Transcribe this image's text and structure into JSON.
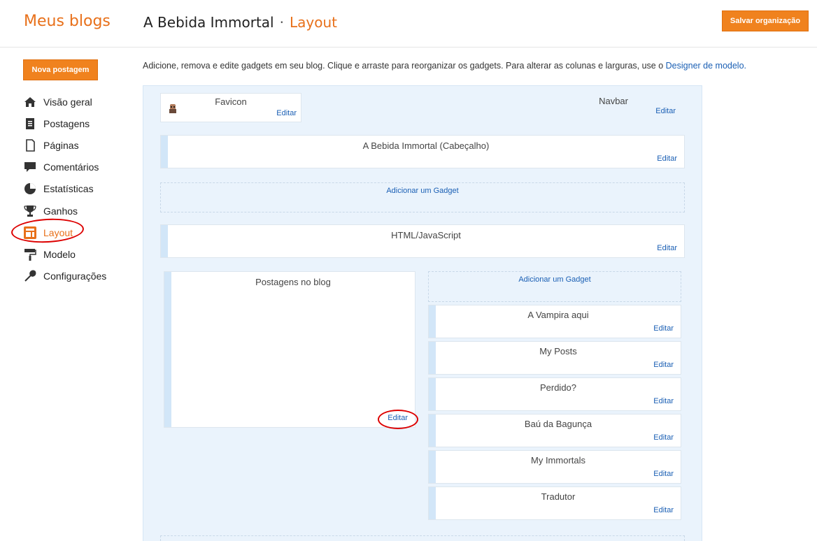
{
  "header": {
    "brand": "Meus blogs",
    "blog_name": "A Bebida Immortal",
    "separator": "·",
    "current": "Layout",
    "save_label": "Salvar organização"
  },
  "sidebar": {
    "new_post_label": "Nova postagem",
    "items": [
      {
        "label": "Visão geral",
        "icon": "home-icon"
      },
      {
        "label": "Postagens",
        "icon": "posts-icon"
      },
      {
        "label": "Páginas",
        "icon": "pages-icon"
      },
      {
        "label": "Comentários",
        "icon": "comment-icon"
      },
      {
        "label": "Estatísticas",
        "icon": "pie-chart-icon"
      },
      {
        "label": "Ganhos",
        "icon": "trophy-icon"
      },
      {
        "label": "Layout",
        "icon": "layout-icon",
        "active": true
      },
      {
        "label": "Modelo",
        "icon": "paint-roller-icon"
      },
      {
        "label": "Configurações",
        "icon": "wrench-icon"
      }
    ]
  },
  "description": {
    "text": "Adicione, remova e edite gadgets em seu blog. Clique e arraste para reorganizar os gadgets. Para alterar as colunas e larguras, use o ",
    "link": "Designer de modelo."
  },
  "layout": {
    "favicon_title": "Favicon",
    "navbar_title": "Navbar",
    "header_title": "A Bebida Immortal (Cabeçalho)",
    "add_gadget": "Adicionar um Gadget",
    "html_title": "HTML/JavaScript",
    "posts_title": "Postagens no blog",
    "edit_label": "Editar",
    "sidebar_gadgets": [
      "A Vampira aqui",
      "My Posts",
      "Perdido?",
      "Baú da Bagunça",
      "My Immortals",
      "Tradutor"
    ]
  },
  "colors": {
    "accent": "#e8701a",
    "button": "#f0821e",
    "link": "#1a5fb4",
    "canvas": "#eaf3fc",
    "annotation": "#dd0000"
  }
}
